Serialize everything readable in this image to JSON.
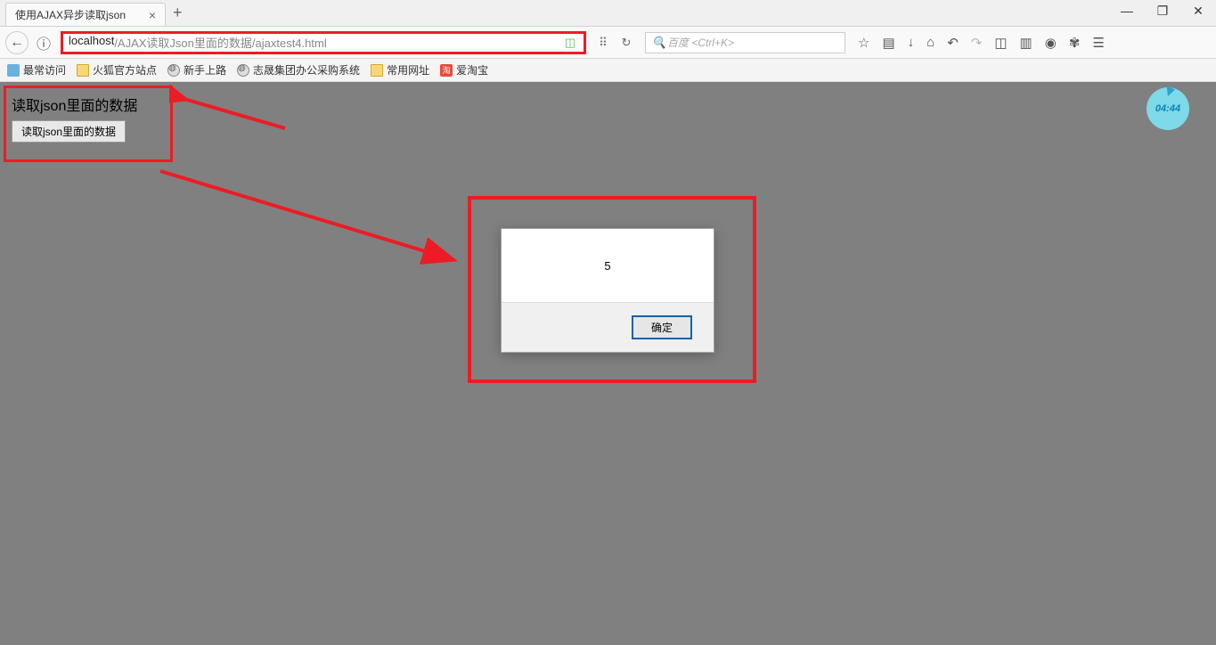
{
  "window": {
    "tab_title": "使用AJAX异步读取json",
    "minimize": "—",
    "maximize": "❐",
    "close": "✕",
    "new_tab": "+"
  },
  "nav": {
    "back": "←",
    "info_icon": "ⓘ",
    "url_host": "localhost",
    "url_path": "/AJAX读取Json里面的数据/ajaxtest4.html",
    "shield_icon": "▾",
    "qr_icon": "⠿",
    "reload_icon": "↻",
    "search_icon": "🔍",
    "search_placeholder": "百度 <Ctrl+K>",
    "star": "☆",
    "library": "▤",
    "download": "↓",
    "home": "⌂",
    "undo": "↶",
    "redo": "↷",
    "pocket": "◫",
    "screenshot": "▥",
    "chat": "◉",
    "paw": "✾",
    "menu": "☰"
  },
  "bookmarks": [
    {
      "label": "最常访问",
      "icon": "grid"
    },
    {
      "label": "火狐官方站点",
      "icon": "folder"
    },
    {
      "label": "新手上路",
      "icon": "globe"
    },
    {
      "label": "志晟集团办公采购系统",
      "icon": "globe"
    },
    {
      "label": "常用网址",
      "icon": "folder"
    },
    {
      "label": "爱淘宝",
      "icon": "red"
    }
  ],
  "page": {
    "heading": "读取json里面的数据",
    "button_label": "读取json里面的数据"
  },
  "alert": {
    "message": "5",
    "ok_label": "确定"
  },
  "timer": {
    "value": "04:44"
  }
}
